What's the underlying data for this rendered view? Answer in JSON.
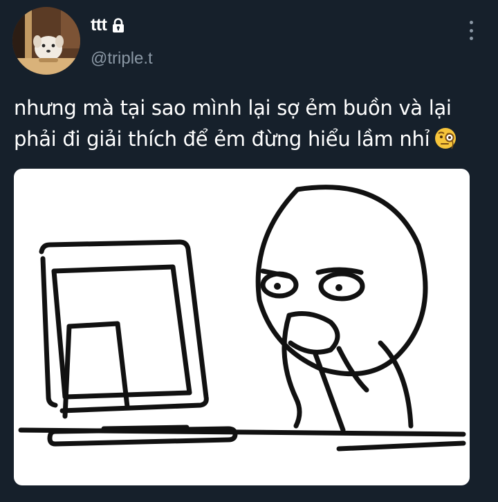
{
  "tweet": {
    "author": {
      "display_name": "ttt",
      "handle": "@triple.t",
      "protected": true,
      "avatar": "avatar-dog-photo"
    },
    "text_lines": [
      "nhưng mà tại sao mình lại sợ ẻm buồn và lại",
      "phải đi giải thích để ẻm đừng hiểu lầm nhỉ"
    ],
    "emoji": "face-with-monocle",
    "media": {
      "type": "image",
      "description_icon": "meme-computer-guy-drawing"
    }
  },
  "icons": {
    "lock": "lock-icon",
    "more": "more-vertical-icon"
  },
  "colors": {
    "background": "#16202b",
    "text_primary": "#ffffff",
    "text_secondary": "#8b98a5",
    "media_bg": "#ffffff"
  }
}
